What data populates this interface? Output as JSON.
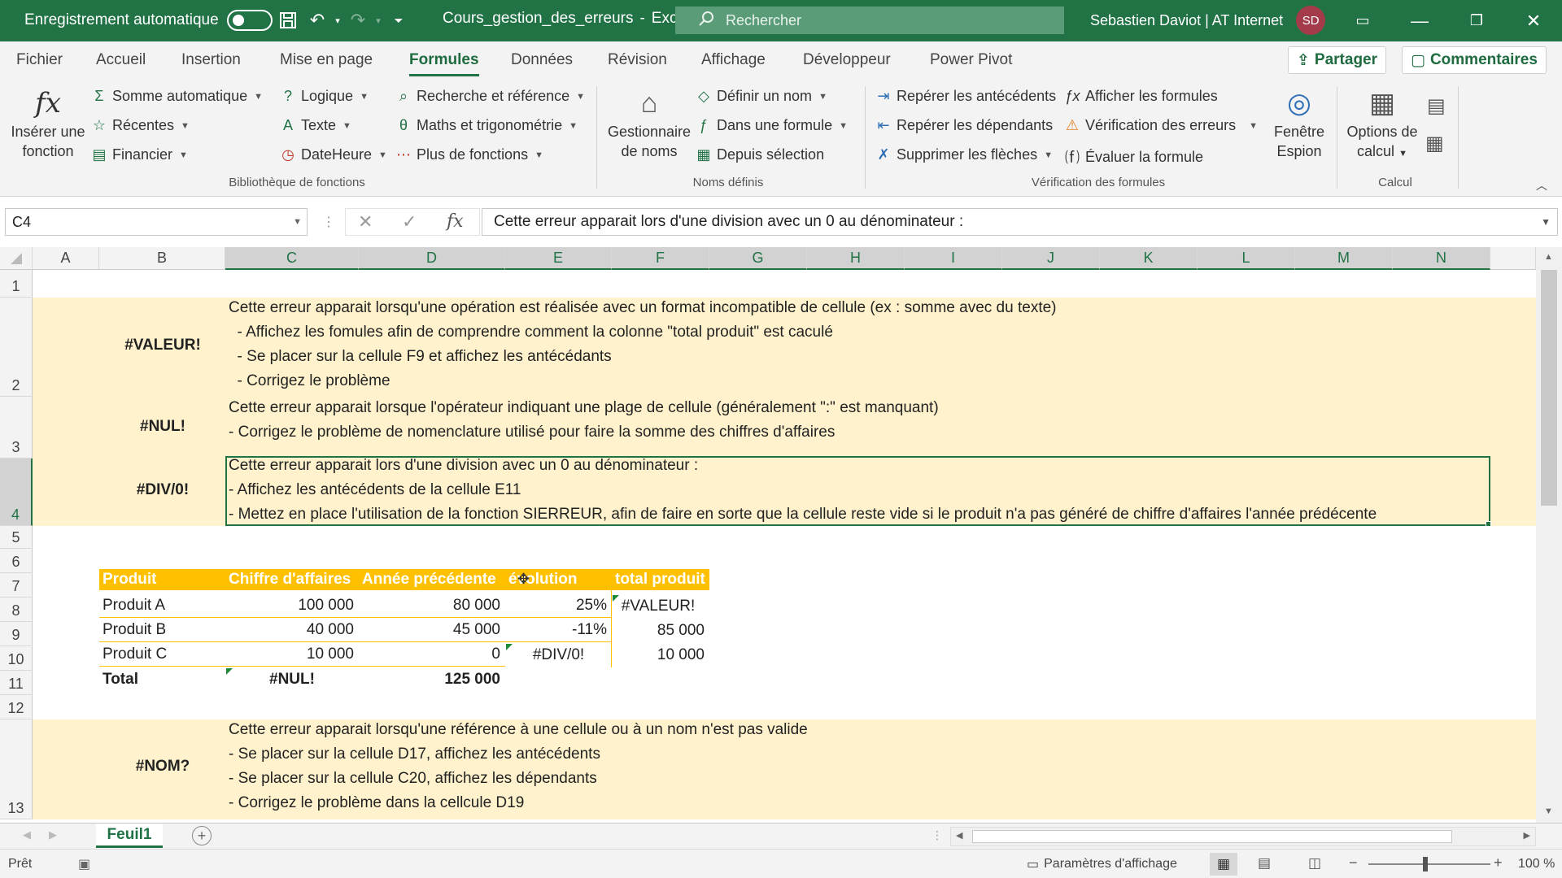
{
  "titlebar": {
    "autosave_label": "Enregistrement automatique",
    "filename": "Cours_gestion_des_erreurs",
    "separator": "-",
    "app": "Excel",
    "search_placeholder": "Rechercher",
    "user": "Sebastien Daviot | AT Internet",
    "initials": "SD"
  },
  "tabs": [
    "Fichier",
    "Accueil",
    "Insertion",
    "Mise en page",
    "Formules",
    "Données",
    "Révision",
    "Affichage",
    "Développeur",
    "Power Pivot"
  ],
  "active_tab": "Formules",
  "share_label": "Partager",
  "comments_label": "Commentaires",
  "ribbon": {
    "insert_function": [
      "Insérer une",
      "fonction"
    ],
    "library": {
      "autosum": "Somme automatique",
      "recent": "Récentes",
      "financial": "Financier",
      "logical": "Logique",
      "text": "Texte",
      "datetime": "DateHeure",
      "lookup": "Recherche et référence",
      "math": "Maths et trigonométrie",
      "more": "Plus de fonctions",
      "group_label": "Bibliothèque de fonctions"
    },
    "names": {
      "manager": [
        "Gestionnaire",
        "de noms"
      ],
      "define": "Définir un nom",
      "in_formula": "Dans une formule",
      "from_selection": "Depuis sélection",
      "group_label": "Noms définis"
    },
    "audit": {
      "precedents": "Repérer les antécédents",
      "dependents": "Repérer les dépendants",
      "remove_arrows": "Supprimer les flèches",
      "show_formulas": "Afficher les formules",
      "error_check": "Vérification des erreurs",
      "evaluate": "Évaluer la formule",
      "watch": [
        "Fenêtre",
        "Espion"
      ],
      "group_label": "Vérification des formules"
    },
    "calc": {
      "options": [
        "Options de",
        "calcul"
      ],
      "group_label": "Calcul"
    }
  },
  "formula_bar": {
    "cell_ref": "C4",
    "content": "Cette erreur apparait lors d'une division avec un 0 au dénominateur :"
  },
  "columns": [
    "A",
    "B",
    "C",
    "D",
    "E",
    "F",
    "G",
    "H",
    "I",
    "J",
    "K",
    "L",
    "M",
    "N"
  ],
  "rows": [
    "1",
    "2",
    "3",
    "4",
    "5",
    "6",
    "7",
    "8",
    "9",
    "10",
    "11",
    "12",
    "13"
  ],
  "errors": {
    "valeur": {
      "label": "#VALEUR!",
      "lines": [
        "Cette erreur apparait lorsqu'une opération est réalisée avec un format incompatible de cellule (ex : somme avec du texte)",
        "  - Affichez les fomules afin de comprendre comment la colonne \"total produit\" est caculé",
        "  - Se placer sur la cellule F9 et affichez les antécédants",
        "  - Corrigez le problème"
      ]
    },
    "nul": {
      "label": "#NUL!",
      "lines": [
        "Cette erreur apparait lorsque l'opérateur indiquant une plage de cellule (généralement \":\" est manquant)",
        "- Corrigez le problème de nomenclature utilisé pour faire la somme des chiffres d'affaires"
      ]
    },
    "div0": {
      "label": "#DIV/0!",
      "lines": [
        "Cette erreur apparait lors d'une division avec un 0 au dénominateur :",
        "- Affichez les antécédents de la cellule E11",
        "- Mettez en place l'utilisation de la fonction SIERREUR, afin de faire en sorte que la cellule reste vide si le produit n'a pas généré de chiffre d'affaires l'année prédécente"
      ]
    },
    "nom": {
      "label": "#NOM?",
      "lines": [
        "Cette erreur apparait lorsqu'une référence à une cellule ou à un nom n'est pas valide",
        "- Se placer sur la cellule D17, affichez les antécédents",
        "- Se placer sur la cellule C20, affichez les dépendants",
        "- Corrigez le problème dans la cellcule D19"
      ]
    }
  },
  "table": {
    "headers": [
      "Produit",
      "Chiffre d'affaires",
      "Année précédente",
      "évolution",
      "total produit"
    ],
    "rows": [
      [
        "Produit A",
        "100 000",
        "80 000",
        "25%",
        "#VALEUR!"
      ],
      [
        "Produit B",
        "40 000",
        "45 000",
        "-11%",
        "85 000"
      ],
      [
        "Produit C",
        "10 000",
        "0",
        "#DIV/0!",
        "10 000"
      ]
    ],
    "total": [
      "Total",
      "#NUL!",
      "125 000"
    ]
  },
  "sheet_tab": "Feuil1",
  "status": {
    "ready": "Prêt",
    "display_settings": "Paramètres d'affichage",
    "zoom": "100 %"
  },
  "colors": {
    "excel_green": "#217346",
    "band": "#fff2cc",
    "table_header": "#ffc000"
  }
}
